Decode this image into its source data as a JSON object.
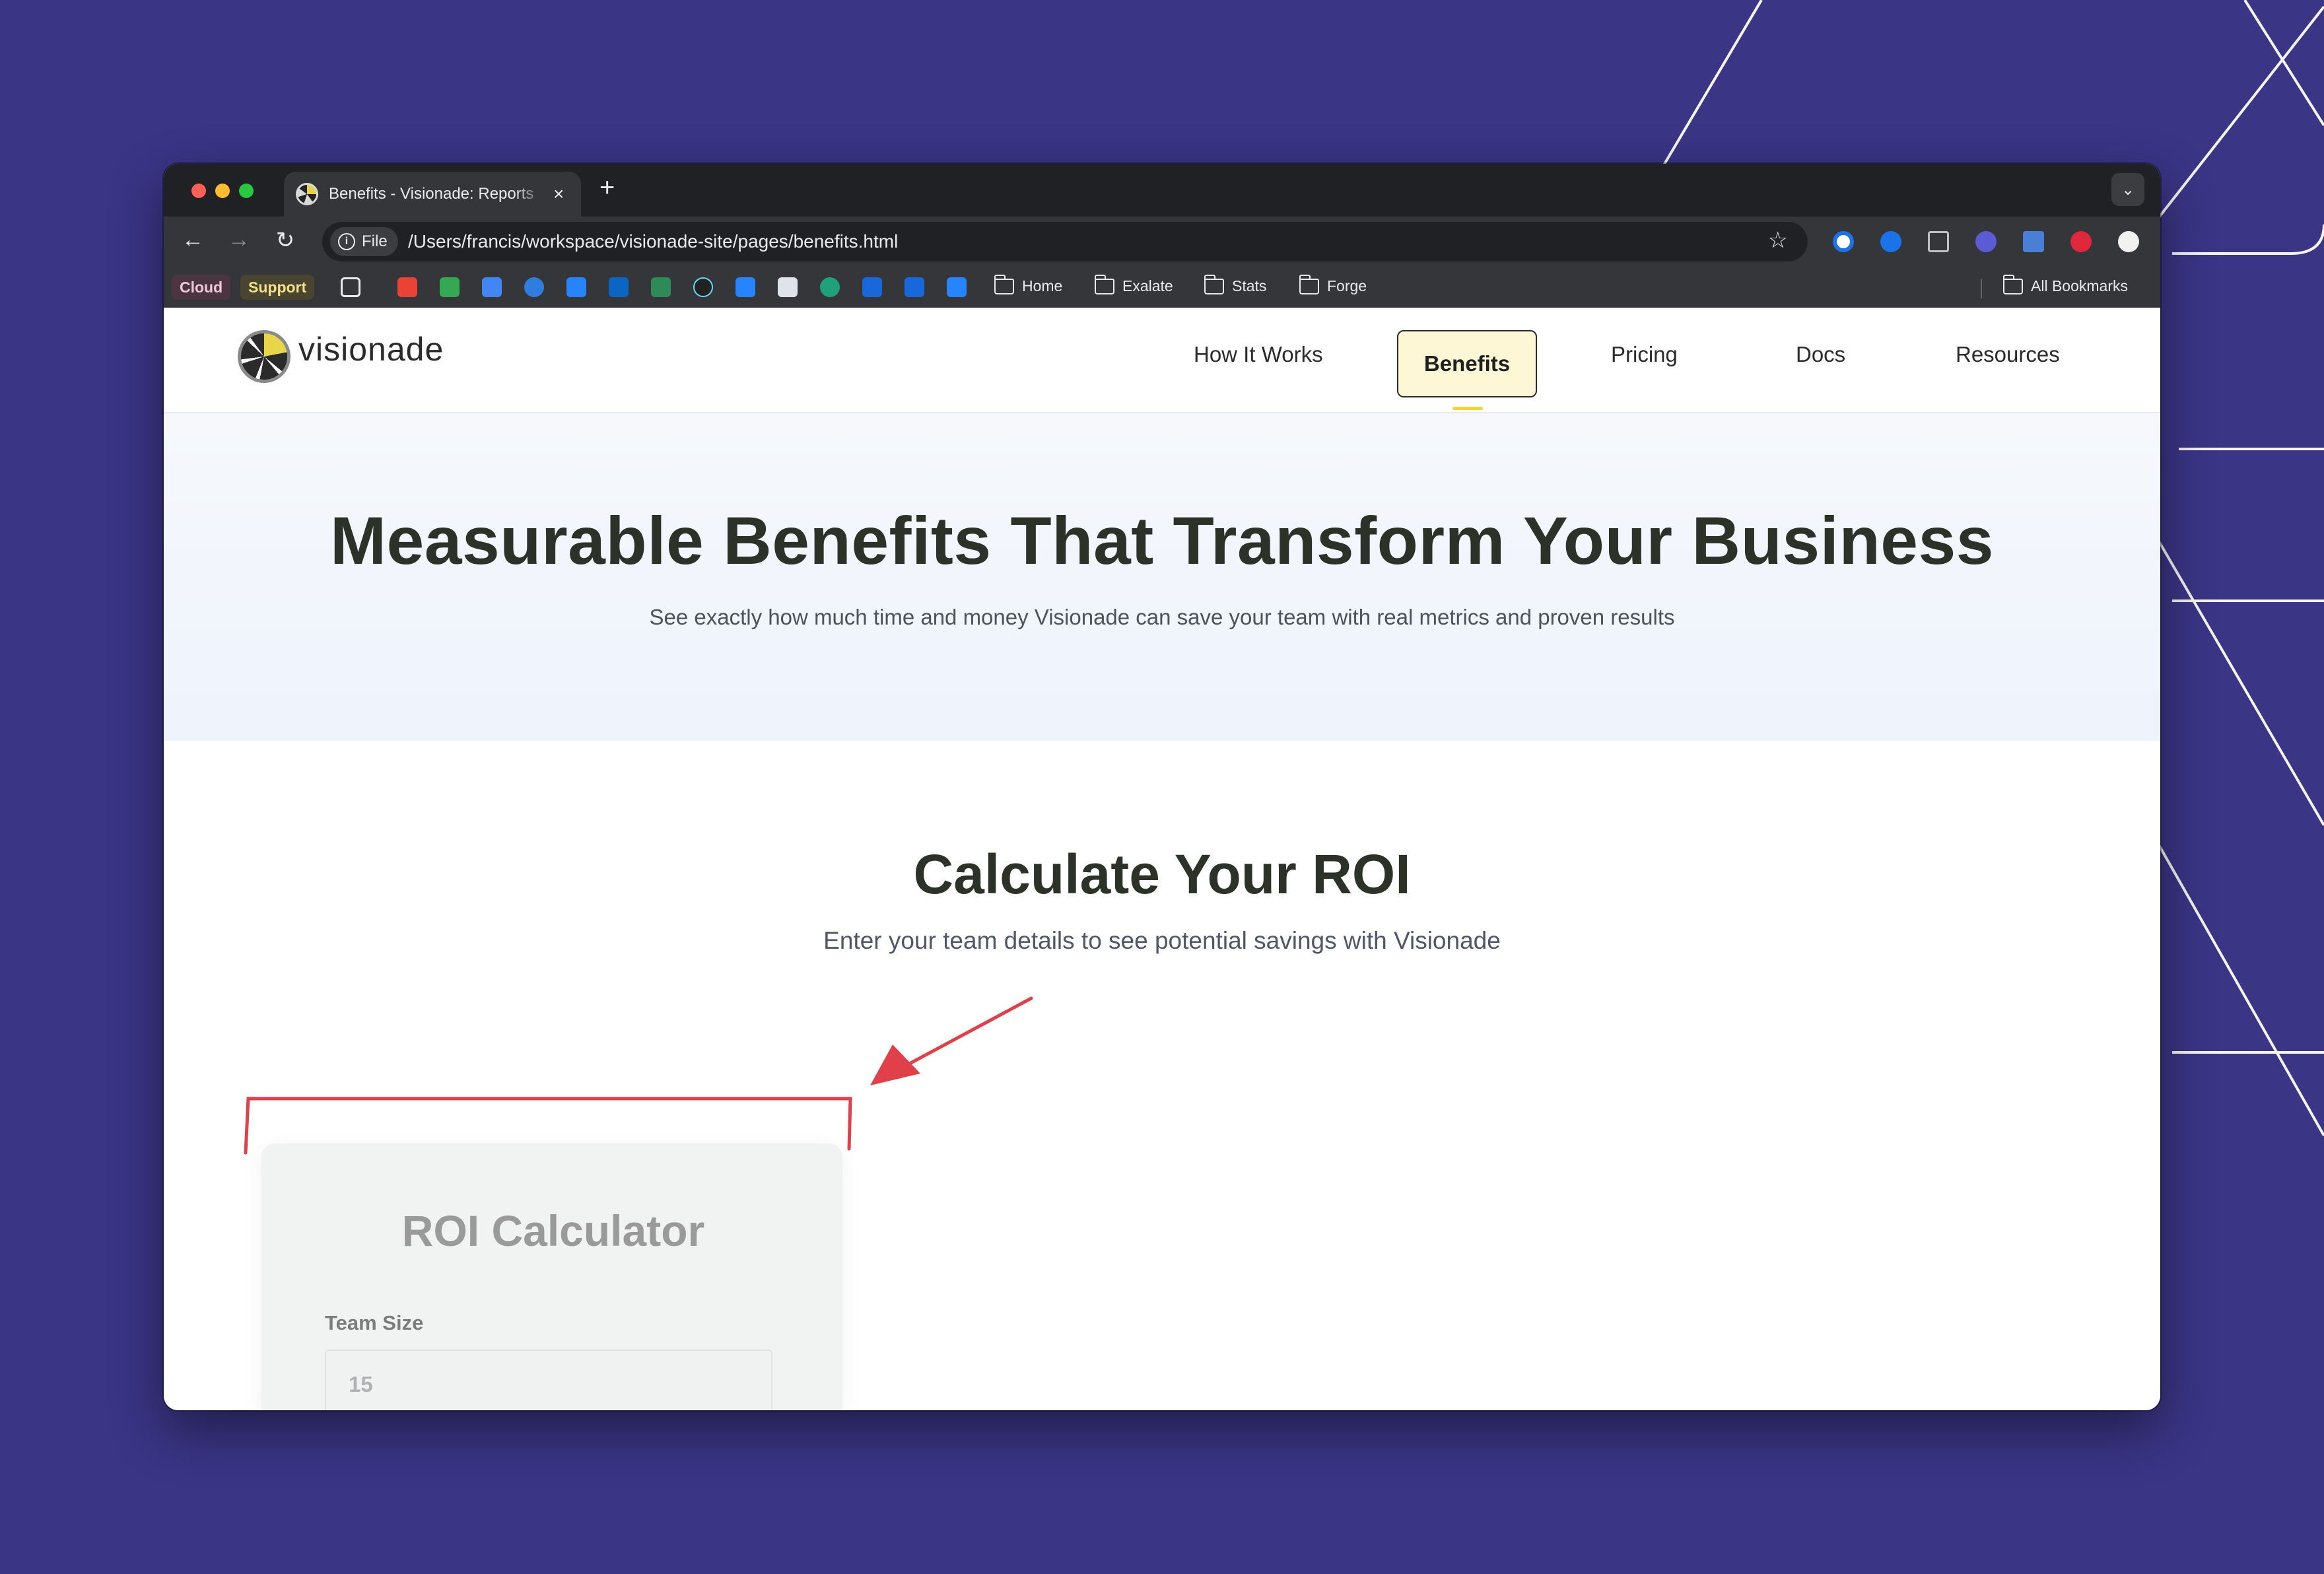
{
  "browser": {
    "tab_title": "Benefits - Visionade: Reports",
    "tab_close": "×",
    "new_tab": "+",
    "tab_menu": "⌄",
    "file_label": "File",
    "url": "/Users/francis/workspace/visionade-site/pages/benefits.html",
    "bookmarks": {
      "cloud": "Cloud",
      "support": "Support",
      "folders": [
        "Home",
        "Exalate",
        "Stats",
        "Forge"
      ],
      "all_bookmarks": "All Bookmarks"
    }
  },
  "site": {
    "logo_text": "visionade",
    "nav": [
      "How It Works",
      "Benefits",
      "Pricing",
      "Docs",
      "Resources"
    ],
    "active_nav": "Benefits",
    "hero": {
      "title": "Measurable Benefits That Transform Your Business",
      "subtitle": "See exactly how much time and money Visionade can save your team with real metrics and proven results"
    },
    "roi": {
      "title": "Calculate Your ROI",
      "subtitle": "Enter your team details to see potential savings with Visionade",
      "card_title": "ROI Calculator",
      "team_size_label": "Team Size",
      "team_size_value": "15"
    }
  },
  "colors": {
    "background": "#3a3585",
    "annotation": "#e0404a",
    "nav_active_bg": "#fdf7d6",
    "nav_underline": "#f0d43a"
  }
}
